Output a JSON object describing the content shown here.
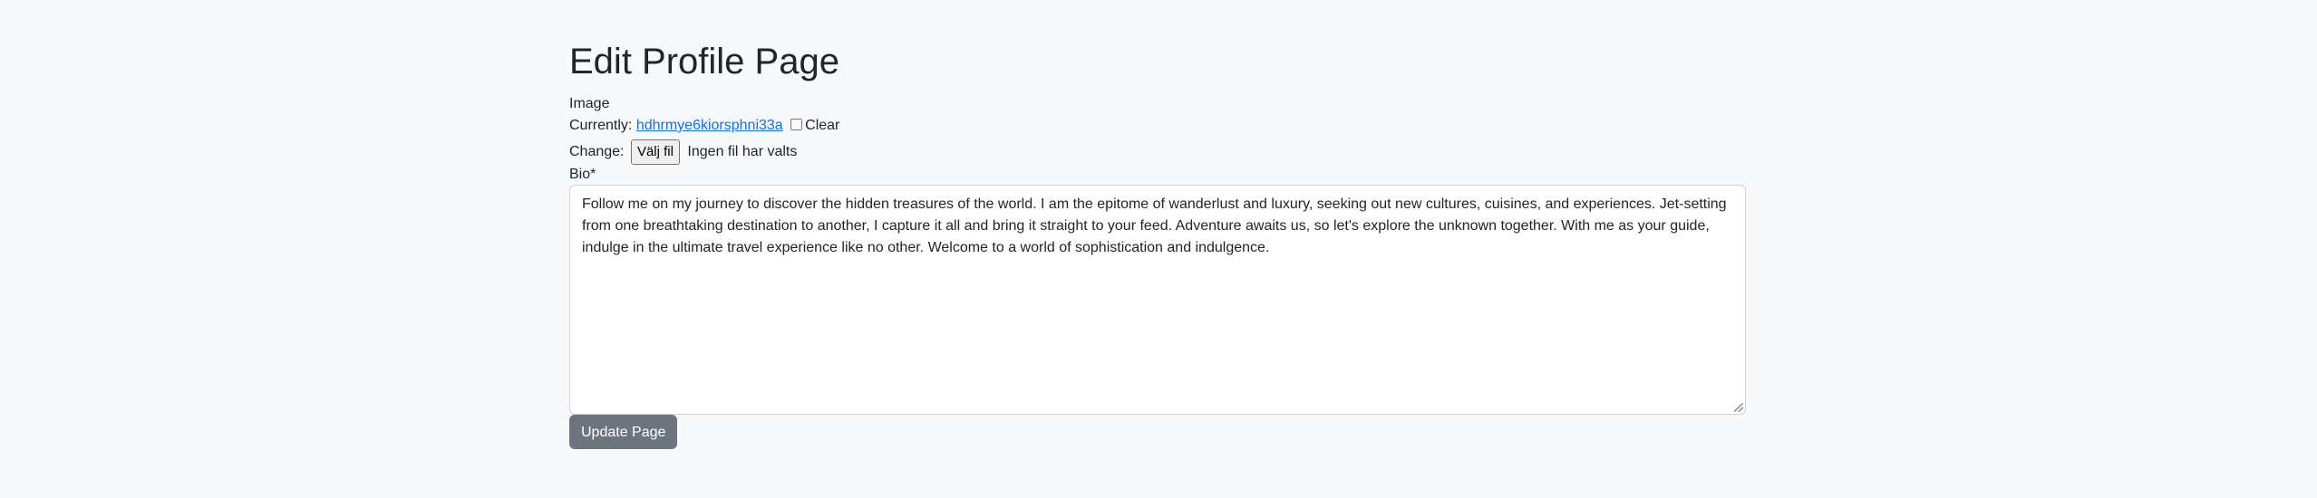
{
  "page": {
    "title": "Edit Profile Page"
  },
  "form": {
    "image": {
      "label": "Image",
      "currently_label": "Currently:",
      "current_file": "hdhrmye6kiorsphni33a",
      "clear_label": "Clear",
      "clear_checked": false,
      "change_label": "Change:",
      "choose_button": "Välj fil",
      "no_file_text": "Ingen fil har valts"
    },
    "bio": {
      "label": "Bio*",
      "value": "Follow me on my journey to discover the hidden treasures of the world. I am the epitome of wanderlust and luxury, seeking out new cultures, cuisines, and experiences. Jet-setting from one breathtaking destination to another, I capture it all and bring it straight to your feed. Adventure awaits us, so let's explore the unknown together. With me as your guide, indulge in the ultimate travel experience like no other. Welcome to a world of sophistication and indulgence."
    },
    "submit_label": "Update Page"
  },
  "colors": {
    "background": "#f8f9fa",
    "link": "#0d6efd",
    "button": "#6c757d"
  }
}
